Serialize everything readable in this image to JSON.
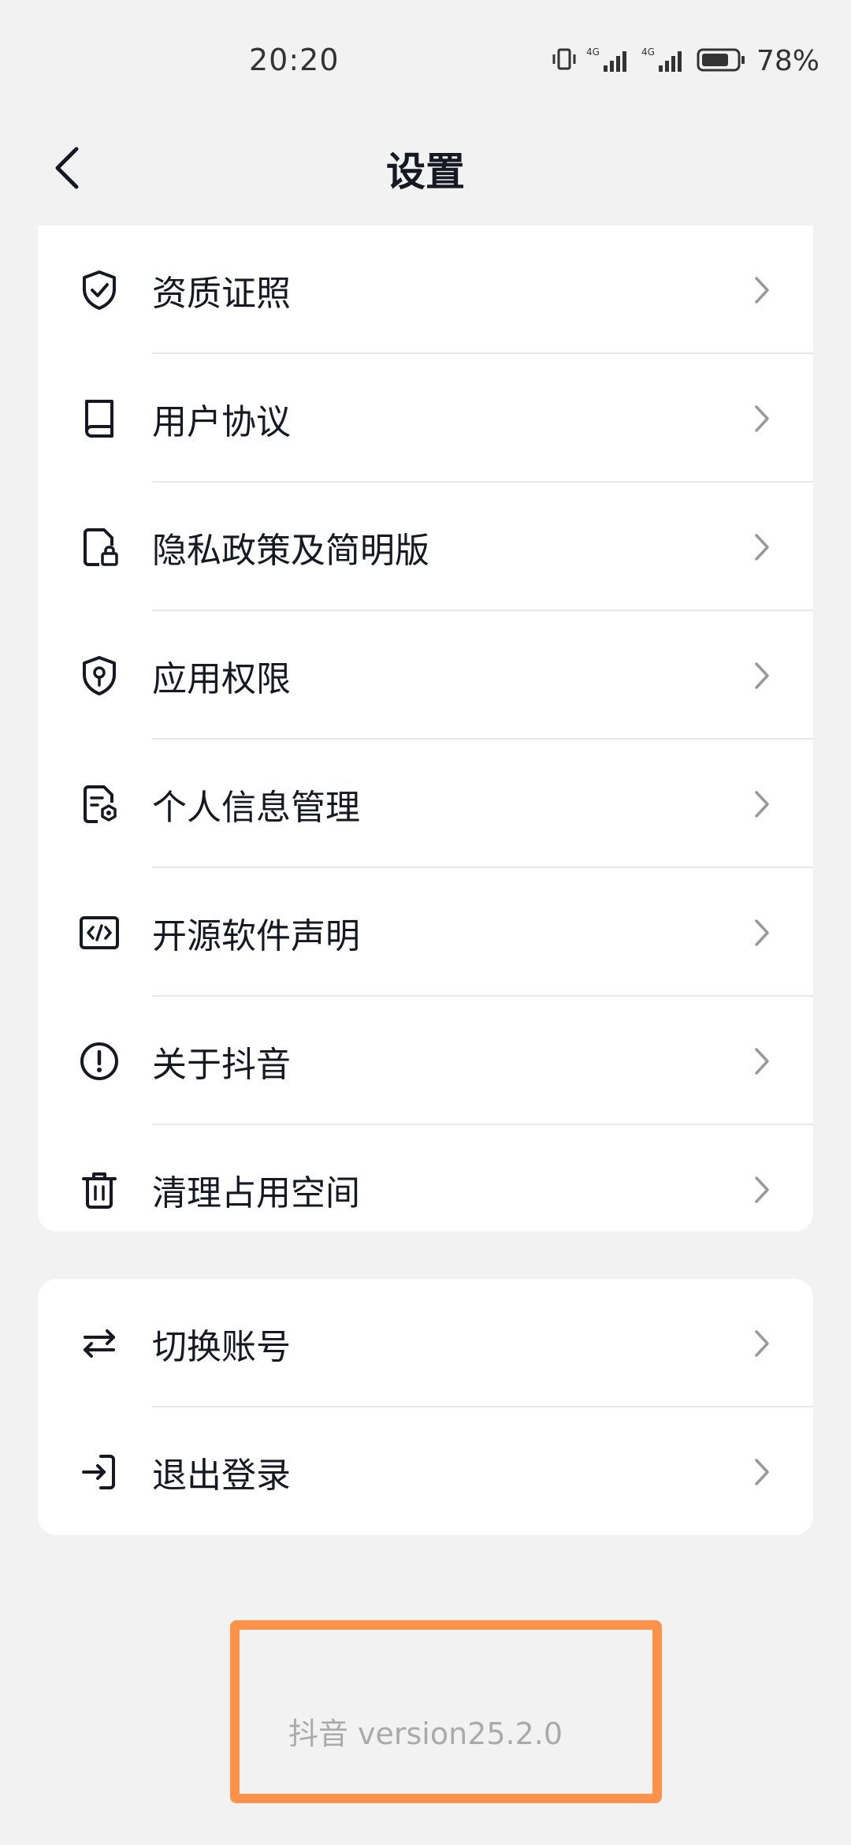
{
  "status_bar": {
    "time": "20:20",
    "battery_percent": "78%",
    "battery_level": 0.78,
    "network_1": "4G",
    "network_2": "4G"
  },
  "header": {
    "title": "设置",
    "back_icon": "chevron-left-icon"
  },
  "settings_list": [
    {
      "label": "资质证照",
      "icon": "shield-check-icon"
    },
    {
      "label": "用户协议",
      "icon": "book-icon"
    },
    {
      "label": "隐私政策及简明版",
      "icon": "document-lock-icon"
    },
    {
      "label": "应用权限",
      "icon": "shield-key-icon"
    },
    {
      "label": "个人信息管理",
      "icon": "document-gear-icon"
    },
    {
      "label": "开源软件声明",
      "icon": "code-icon"
    },
    {
      "label": "关于抖音",
      "icon": "info-circle-icon"
    },
    {
      "label": "清理占用空间",
      "icon": "trash-icon"
    }
  ],
  "account_list": [
    {
      "label": "切换账号",
      "icon": "swap-icon"
    },
    {
      "label": "退出登录",
      "icon": "logout-icon"
    }
  ],
  "footer": {
    "version_text": "抖音 version25.2.0"
  },
  "colors": {
    "background": "#f2f2f2",
    "card": "#ffffff",
    "text": "#161823",
    "chevron": "#999999",
    "highlight": "#ff9249",
    "version_text": "#aaaaaa"
  }
}
